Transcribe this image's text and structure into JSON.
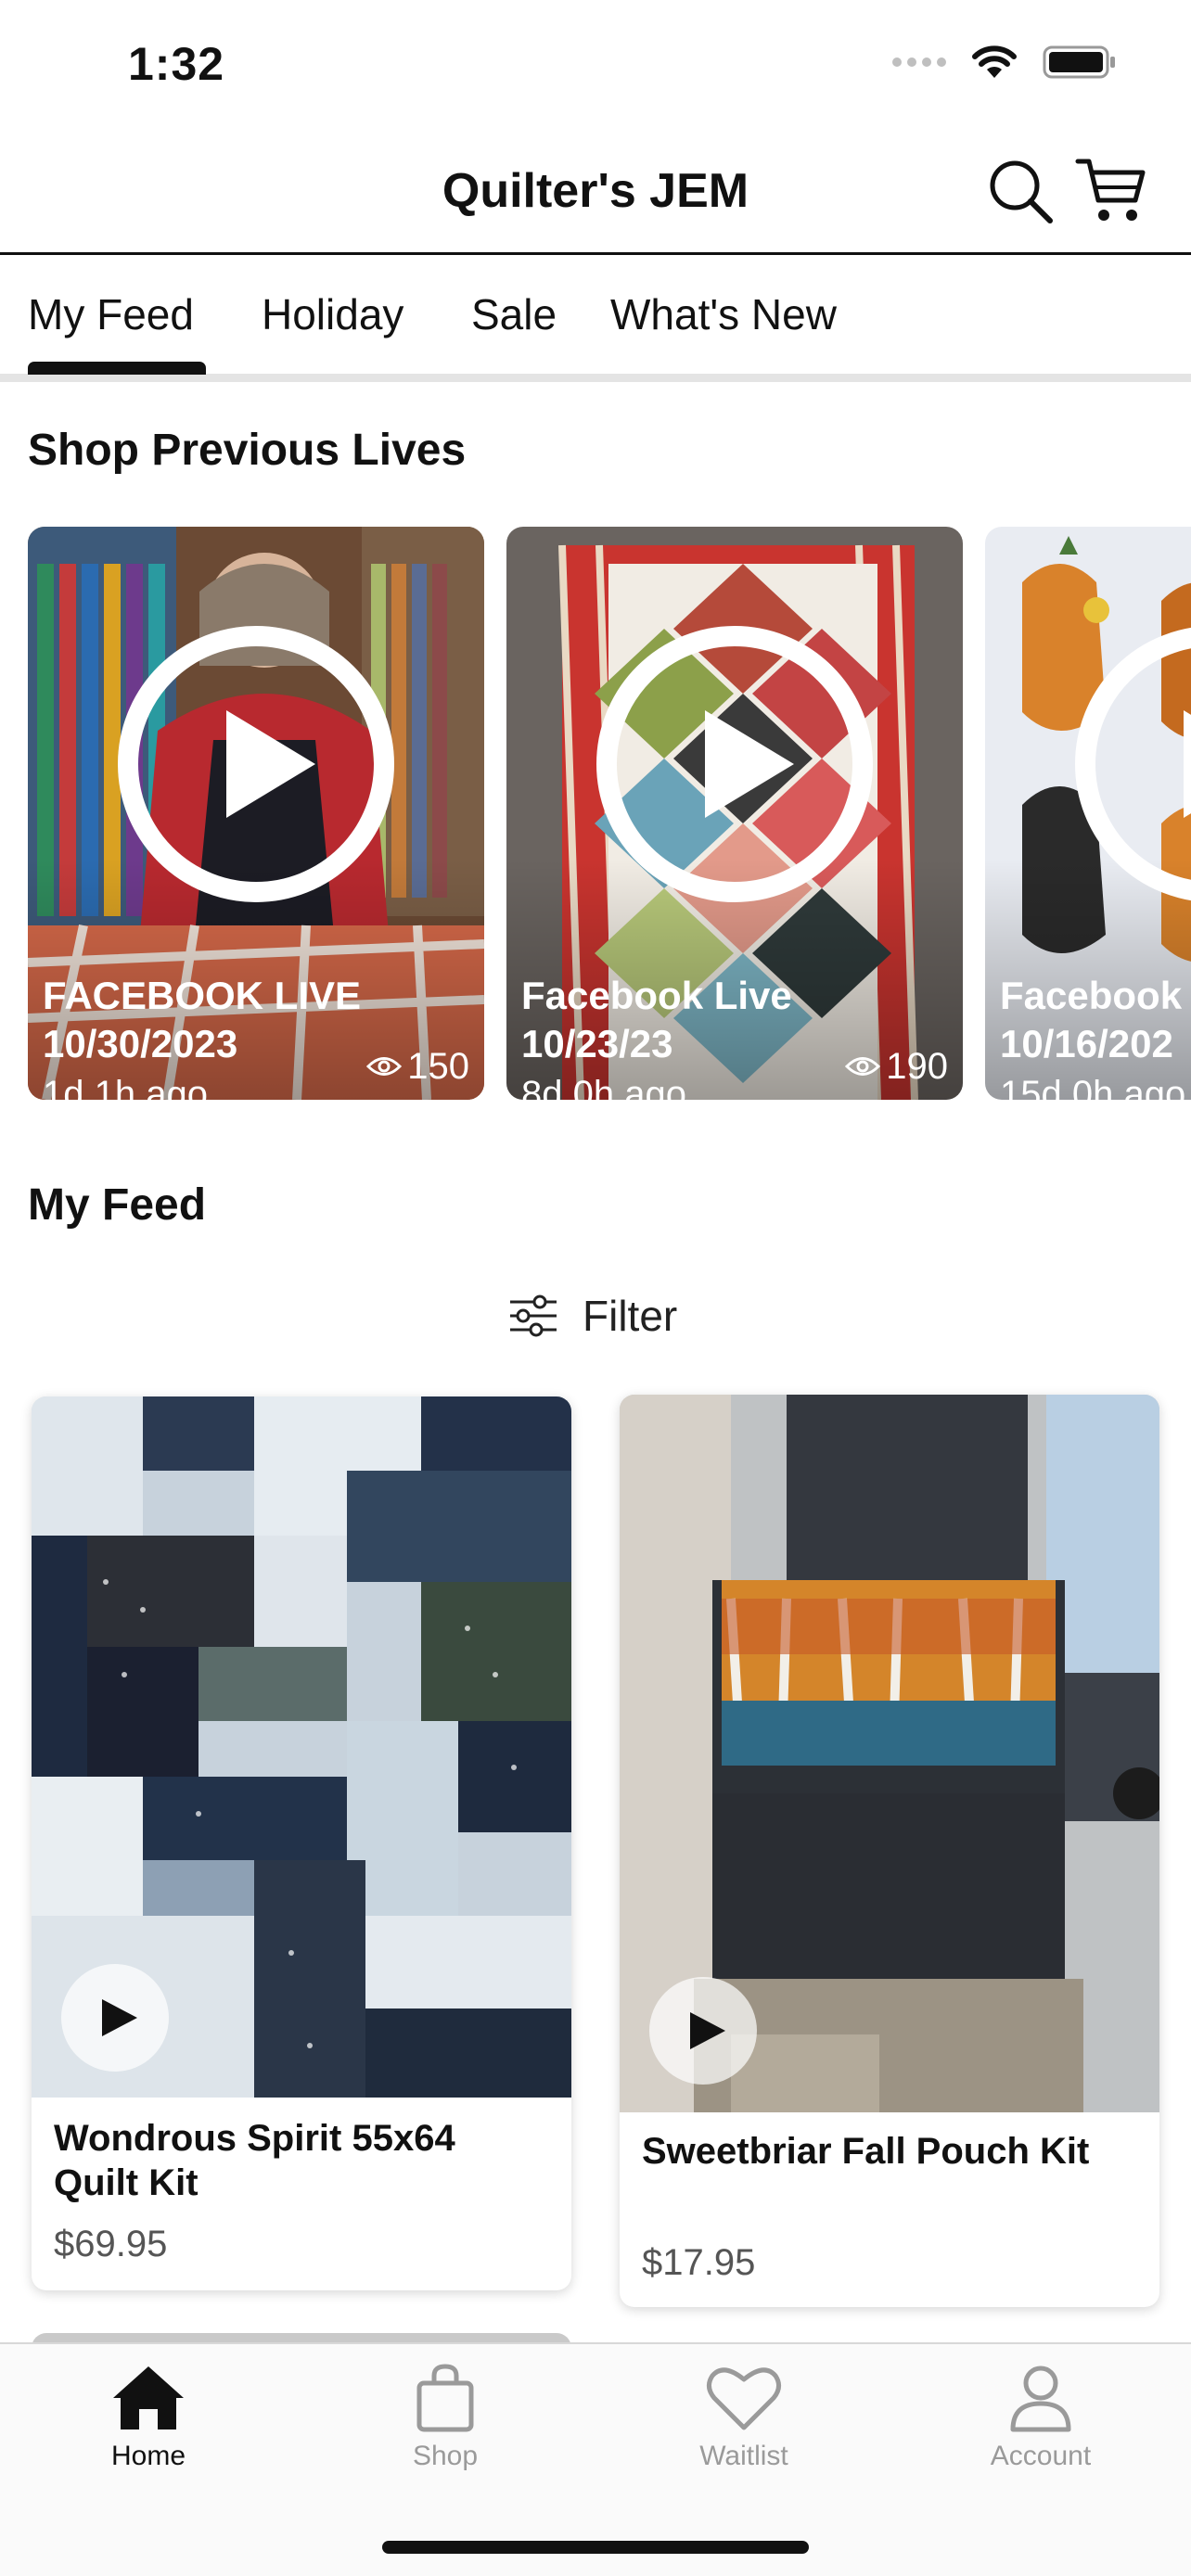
{
  "status_bar": {
    "time": "1:32"
  },
  "header": {
    "title": "Quilter's JEM"
  },
  "tabs": [
    {
      "label": "My Feed"
    },
    {
      "label": "Holiday"
    },
    {
      "label": "Sale"
    },
    {
      "label": "What's New"
    }
  ],
  "lives": {
    "section_title": "Shop Previous Lives",
    "cards": [
      {
        "title": "FACEBOOK LIVE",
        "date": "10/30/2023",
        "ago": "1d 1h ago",
        "views": "150"
      },
      {
        "title": "Facebook Live",
        "date": "10/23/23",
        "ago": "8d 0h ago",
        "views": "190"
      },
      {
        "title": "Facebook Live",
        "date": "10/16/202",
        "ago": "15d 0h ago",
        "views": ""
      }
    ]
  },
  "feed": {
    "section_title": "My Feed",
    "filter_label": "Filter",
    "products": [
      {
        "name_line1": "Wondrous Spirit 55x64",
        "name_line2": "Quilt Kit",
        "price": "$69.95"
      },
      {
        "name_line1": "Sweetbriar Fall Pouch Kit",
        "name_line2": "",
        "price": "$17.95"
      }
    ]
  },
  "bottom_nav": [
    {
      "label": "Home",
      "icon": "home-icon",
      "active": true
    },
    {
      "label": "Shop",
      "icon": "shopping-bag-icon",
      "active": false
    },
    {
      "label": "Waitlist",
      "icon": "heart-icon",
      "active": false
    },
    {
      "label": "Account",
      "icon": "person-icon",
      "active": false
    }
  ],
  "colors": {
    "accent": "#111111",
    "inactive": "#9a9a9a",
    "divider": "#e4e4e4"
  }
}
